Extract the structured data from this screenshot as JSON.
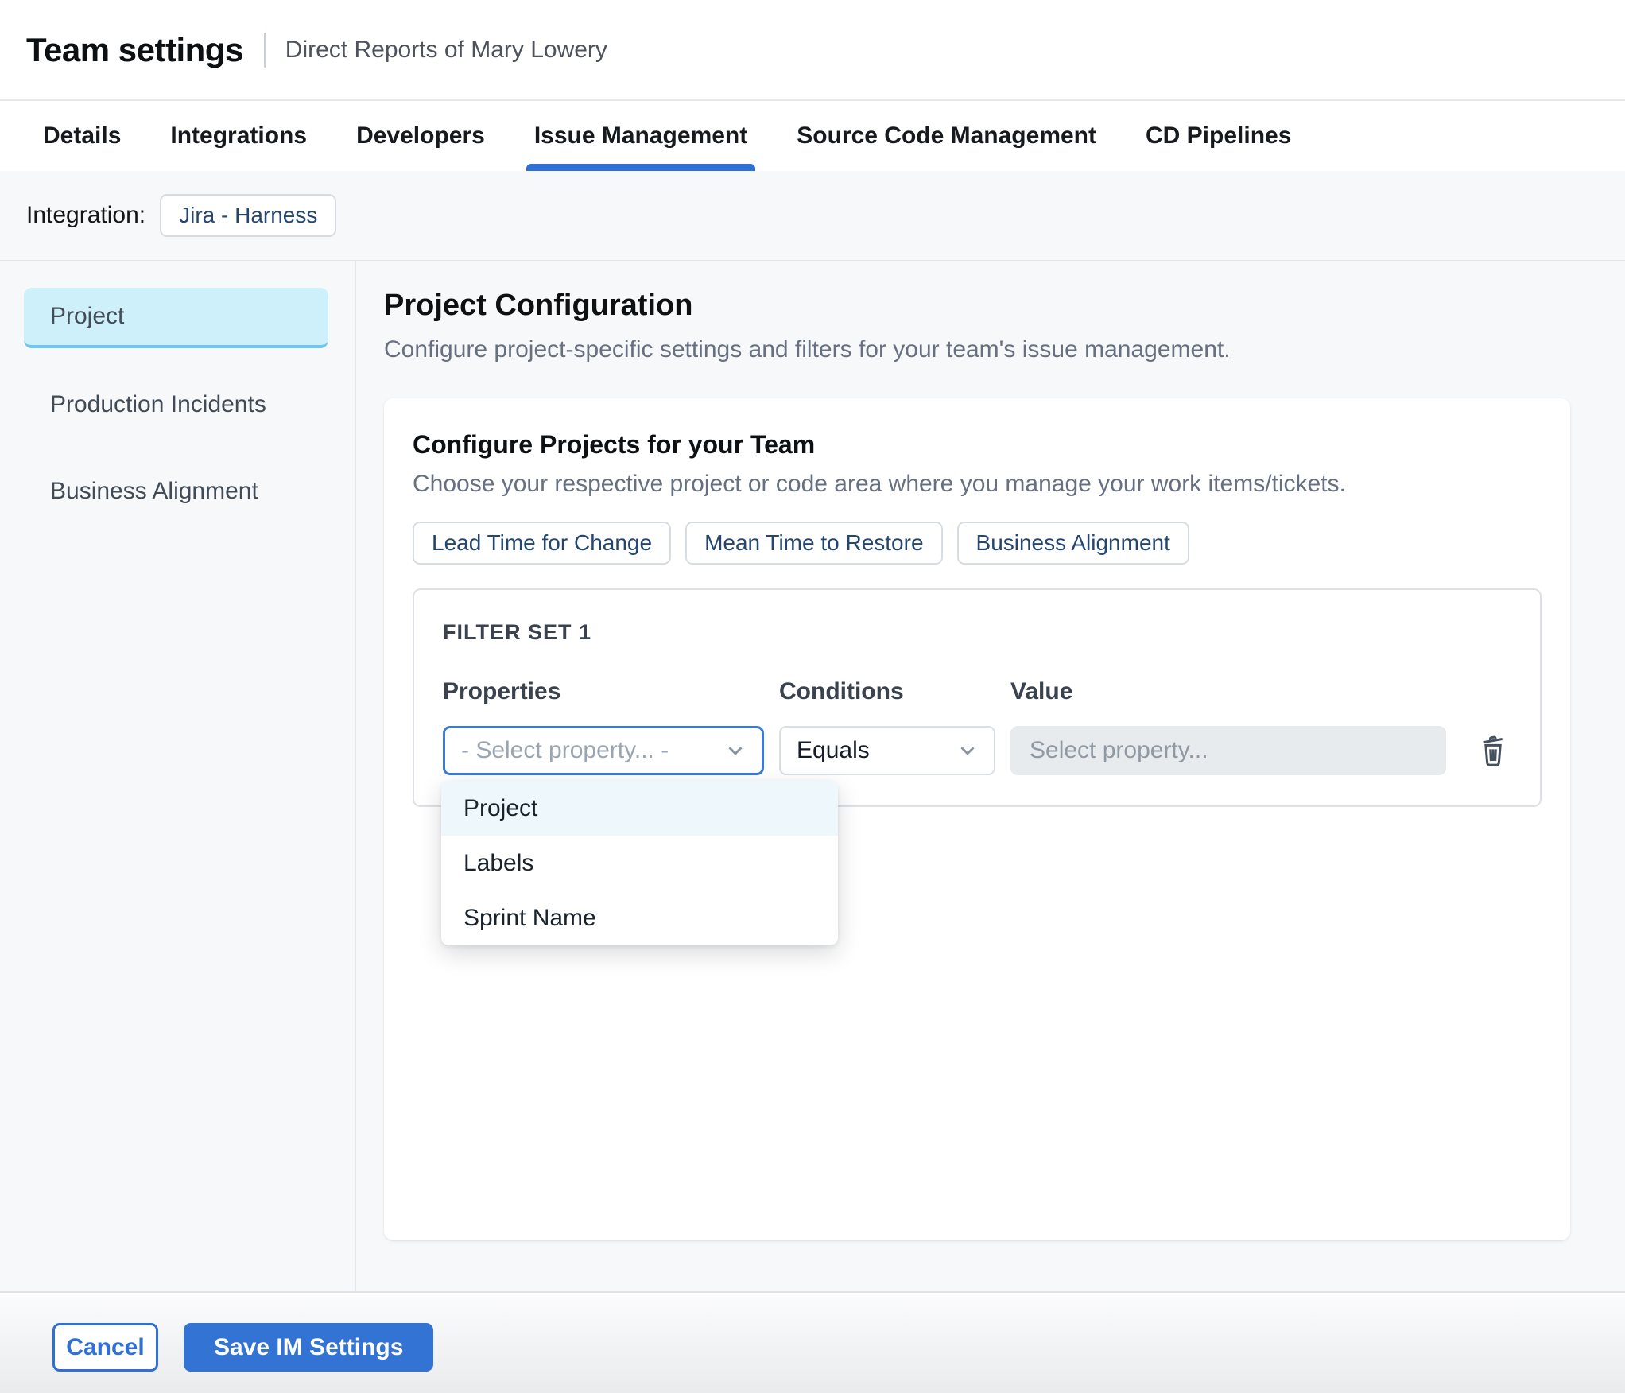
{
  "header": {
    "title": "Team settings",
    "subtitle": "Direct Reports of Mary Lowery"
  },
  "tabs": [
    {
      "label": "Details"
    },
    {
      "label": "Integrations"
    },
    {
      "label": "Developers"
    },
    {
      "label": "Issue Management"
    },
    {
      "label": "Source Code Management"
    },
    {
      "label": "CD Pipelines"
    }
  ],
  "active_tab": "Issue Management",
  "integration": {
    "label": "Integration:",
    "value": "Jira - Harness"
  },
  "sidebar": {
    "items": [
      {
        "label": "Project",
        "active": true
      },
      {
        "label": "Production Incidents",
        "active": false
      },
      {
        "label": "Business Alignment",
        "active": false
      }
    ]
  },
  "main": {
    "title": "Project Configuration",
    "description": "Configure project-specific settings and filters for your team's issue management.",
    "card": {
      "title": "Configure Projects for your Team",
      "description": "Choose your respective project or code area where you manage your work items/tickets.",
      "metric_tabs": [
        {
          "label": "Lead Time for Change"
        },
        {
          "label": "Mean Time to Restore"
        },
        {
          "label": "Business Alignment"
        }
      ],
      "filter_set": {
        "title": "FILTER SET 1",
        "columns": [
          {
            "label": "Properties"
          },
          {
            "label": "Conditions"
          },
          {
            "label": "Value"
          }
        ],
        "property_placeholder": "- Select property... -",
        "condition_value": "Equals",
        "value_placeholder": "Select property...",
        "options": [
          {
            "label": "Project",
            "highlighted": true
          },
          {
            "label": "Labels",
            "highlighted": false
          },
          {
            "label": "Sprint Name",
            "highlighted": false
          }
        ]
      }
    }
  },
  "footer": {
    "cancel_label": "Cancel",
    "save_label": "Save IM Settings"
  },
  "colors": {
    "accent_blue": "#3070D4",
    "save_button_bg": "#3273D4",
    "sidebar_active_bg": "#CDF0FB",
    "sidebar_active_border": "#6FC8EC",
    "dropdown_highlight_bg": "#EDF7FC",
    "value_input_bg": "#E7EBEE",
    "chip_text": "#24466F",
    "page_section_bg": "#F6F8FA",
    "focus_border": "#3B7ADB"
  }
}
